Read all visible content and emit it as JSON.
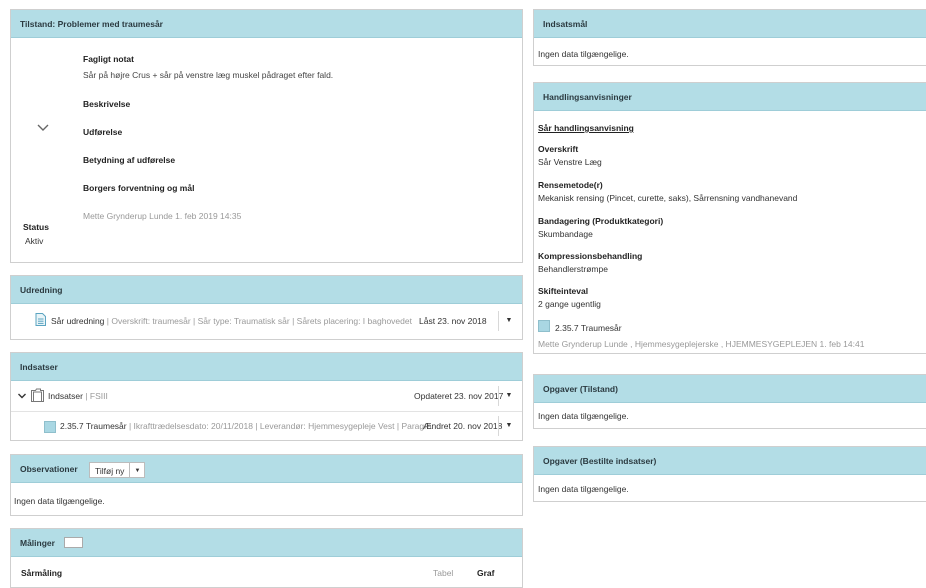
{
  "tilstand": {
    "title": "Tilstand: Problemer med traumesår",
    "fagligt_notat_label": "Fagligt notat",
    "fagligt_notat_text": "Sår på højre Crus + sår på venstre læg muskel pådraget efter fald.",
    "beskrivelse_label": "Beskrivelse",
    "udfoerelse_label": "Udførelse",
    "betydning_label": "Betydning af udførelse",
    "forventning_label": "Borgers forventning og mål",
    "author_line": "Mette Grynderup Lunde 1. feb 2019 14:35",
    "status_label": "Status",
    "status_value": "Aktiv"
  },
  "udredning": {
    "title": "Udredning",
    "item_name": "Sår udredning",
    "item_details": " | Overskrift: traumesår | Sår type: Traumatisk sår | Sårets placering: I baghovedet",
    "item_date": "Låst 23. nov 2018"
  },
  "indsatser": {
    "title": "Indsatser",
    "folder_name": "Indsatser",
    "folder_suffix": " | FSIII",
    "folder_date": "Opdateret 23. nov 2017",
    "child_name": "2.35.7 Traumesår",
    "child_details": " | Ikrafttrædelsesdato: 20/11/2018 | Leverandør: Hjemmesygepleje Vest | Paragra",
    "child_date": "Ændret 20. nov 2018"
  },
  "observationer": {
    "title": "Observationer",
    "add_button": "Tilføj ny",
    "empty": "Ingen data tilgængelige."
  },
  "maalinger": {
    "title": "Målinger",
    "row_label": "Sårmåling",
    "tab_table": "Tabel",
    "tab_graph": "Graf"
  },
  "indsatsmaal": {
    "title": "Indsatsmål",
    "empty": "Ingen data tilgængelige."
  },
  "handlingsanvisninger": {
    "title": "Handlingsanvisninger",
    "link": "Sår handlingsanvisning",
    "overskrift_label": "Overskrift",
    "overskrift_value": "Sår Venstre Læg",
    "rensemetode_label": "Rensemetode(r)",
    "rensemetode_value": "Mekanisk rensing (Pincet, curette, saks), Sårrensning vandhanevand",
    "bandagering_label": "Bandagering (Produktkategori)",
    "bandagering_value": "Skumbandage",
    "kompression_label": "Kompressionsbehandling",
    "kompression_value": "Behandlerstrømpe",
    "skifte_label": "Skifteinteval",
    "skifte_value": "2 gange ugentlig",
    "item_name": "2.35.7 Traumesår",
    "author_line": "Mette Grynderup Lunde , Hjemmesygeplejerske , HJEMMESYGEPLEJEN  1. feb 14:41"
  },
  "opgaver_tilstand": {
    "title": "Opgaver (Tilstand)",
    "empty": "Ingen data tilgængelige."
  },
  "opgaver_bestilte": {
    "title": "Opgaver (Bestilte indsatser)",
    "empty": "Ingen data tilgængelige."
  },
  "colors": {
    "header_bg": "#b3dde6",
    "item_square": "#a9d7e3"
  }
}
